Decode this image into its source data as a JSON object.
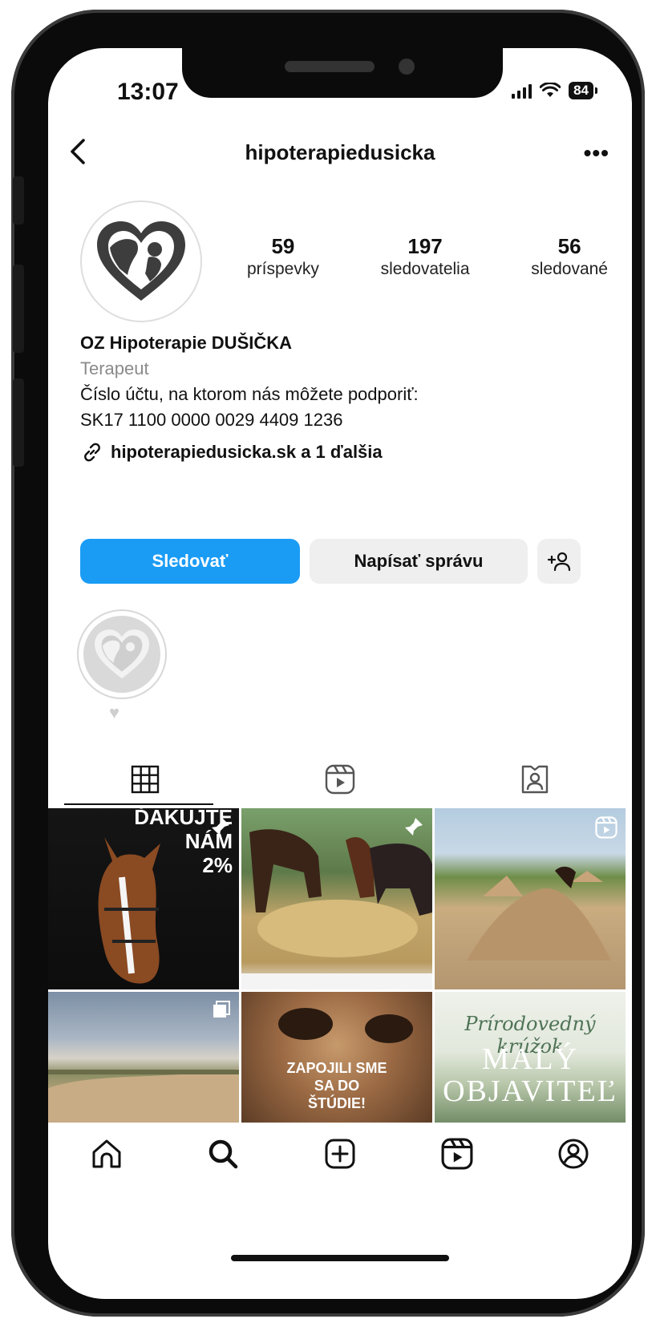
{
  "status_bar": {
    "time": "13:07",
    "battery": "84"
  },
  "header": {
    "username": "hipoterapiedusicka"
  },
  "profile": {
    "stats": [
      {
        "value": "59",
        "label": "príspevky"
      },
      {
        "value": "197",
        "label": "sledovatelia"
      },
      {
        "value": "56",
        "label": "sledované"
      }
    ],
    "name": "OZ Hipoterapie DUŠIČKA",
    "category": "Terapeut",
    "bio_line1": "Číslo účtu, na ktorom nás môžete podporiť:",
    "bio_line2": "SK17 1100 0000 0029 4409 1236",
    "link": "hipoterapiedusicka.sk a 1 ďalšia"
  },
  "buttons": {
    "follow": "Sledovať",
    "message": "Napísať správu"
  },
  "highlights": [
    {
      "label": "♥"
    }
  ],
  "posts": [
    {
      "title_line1": "ĎAKUJTE",
      "title_line2": "NÁM",
      "title_line3": "2%"
    },
    {},
    {},
    {},
    {
      "text_line1": "ZAPOJILI SME",
      "text_line2": "SA DO",
      "text_line3": "ŠTÚDIE!"
    },
    {
      "script": "Prírodovedný krúžok",
      "title_line1": "MALÝ",
      "title_line2": "OBJAVITEĽ"
    }
  ],
  "colors": {
    "follow_button": "#1a9cf5",
    "secondary_button": "#efefef",
    "text": "#111111"
  }
}
